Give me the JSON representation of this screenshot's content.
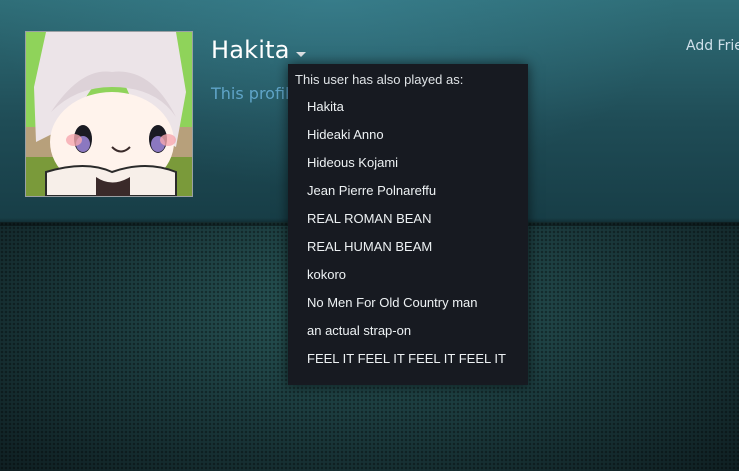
{
  "profile": {
    "persona_name": "Hakita",
    "note_text": "This profil",
    "add_friend_label": "Add Frie"
  },
  "aliases_popup": {
    "header": "This user has also played as:",
    "items": [
      "Hakita",
      "Hideaki Anno",
      "Hideous Kojami",
      "Jean Pierre Polnareffu",
      "REAL ROMAN BEAN",
      "REAL HUMAN BEAM",
      "kokoro",
      "No Men For Old Country man",
      "an actual strap-on",
      "FEEL IT FEEL IT FEEL IT FEEL IT"
    ]
  },
  "icons": {
    "persona_caret": "chevron-down-icon"
  },
  "colors": {
    "persona_name": "#ffffff",
    "profile_note": "#5fa4c8",
    "popup_background": "#171a21"
  }
}
